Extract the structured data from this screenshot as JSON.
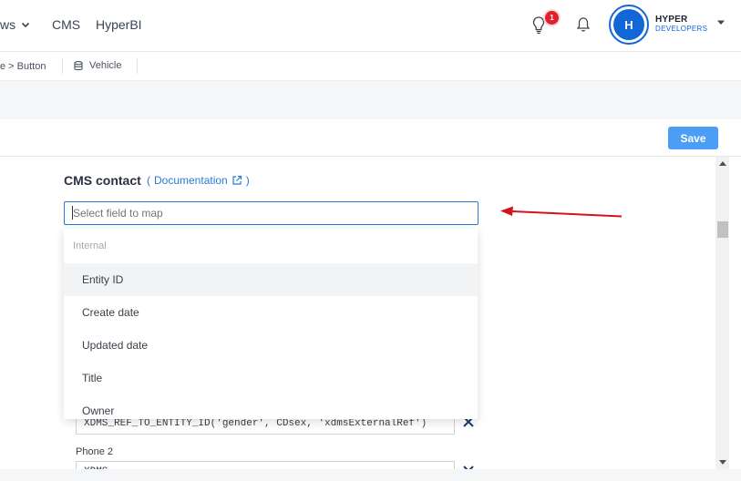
{
  "nav": {
    "views_label": "ws",
    "cms_label": "CMS",
    "hyperbi_label": "HyperBI",
    "notification_count": "1"
  },
  "user": {
    "avatar_letter": "H",
    "brand_name": "HYPER",
    "brand_sub": "DEVELOPERS"
  },
  "breadcrumb": {
    "path": "e > Button",
    "entity": "Vehicle"
  },
  "toolbar": {
    "save_label": "Save"
  },
  "section": {
    "title": "CMS contact",
    "doc_open": "(",
    "doc_link": "Documentation",
    "doc_close": ")"
  },
  "field": {
    "placeholder": "Select field to map"
  },
  "dropdown": {
    "group_label": "Internal",
    "items": [
      "Entity ID",
      "Create date",
      "Updated date",
      "Title",
      "Owner"
    ]
  },
  "behind": {
    "row1_value": "XDMS_REF_TO_ENTITY_ID('gender', CDsex, 'xdmsExternalRef')",
    "phone2_label": "Phone 2",
    "row2_value": "XDMS"
  },
  "colors": {
    "accent": "#2a7ad3",
    "save_button": "#4c9df5",
    "brand_blue": "#1266d6",
    "badge_red": "#e0202a",
    "arrow_red": "#d6121a"
  }
}
